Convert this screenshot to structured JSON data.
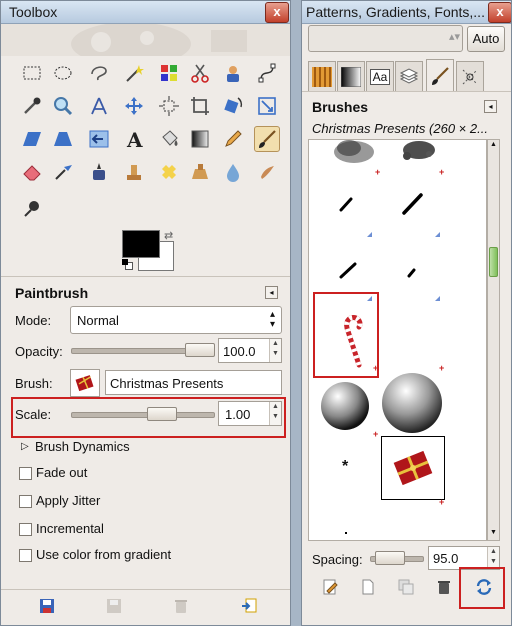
{
  "toolbox": {
    "title": "Toolbox",
    "close_label": "x",
    "tool_options": {
      "heading": "Paintbrush",
      "mode_label": "Mode:",
      "mode_value": "Normal",
      "opacity_label": "Opacity:",
      "opacity_value": "100.0",
      "opacity_fraction": 1.0,
      "brush_label": "Brush:",
      "brush_value": "Christmas Presents",
      "scale_label": "Scale:",
      "scale_value": "1.00",
      "brush_dynamics_label": "Brush Dynamics",
      "checkboxes": [
        {
          "label": "Fade out",
          "checked": false
        },
        {
          "label": "Apply Jitter",
          "checked": false
        },
        {
          "label": "Incremental",
          "checked": false
        },
        {
          "label": "Use color from gradient",
          "checked": false
        }
      ]
    },
    "colors": {
      "foreground": "#000000",
      "background": "#ffffff"
    }
  },
  "dock": {
    "title": "Patterns, Gradients, Fonts,...",
    "close_label": "x",
    "auto_label": "Auto",
    "tabs": [
      "patterns-tab",
      "gradients-tab",
      "fonts-tab",
      "documents-tab",
      "brushes-tab",
      "tool-presets-tab"
    ],
    "fonts_tab_label": "Aa",
    "brushes": {
      "heading": "Brushes",
      "selected": "Christmas Presents (260 × 2...",
      "spacing_label": "Spacing:",
      "spacing_value": "95.0",
      "spacing_fraction": 0.19
    }
  },
  "highlight_color": "#cc2020",
  "accent_color": "#6d8fd4"
}
